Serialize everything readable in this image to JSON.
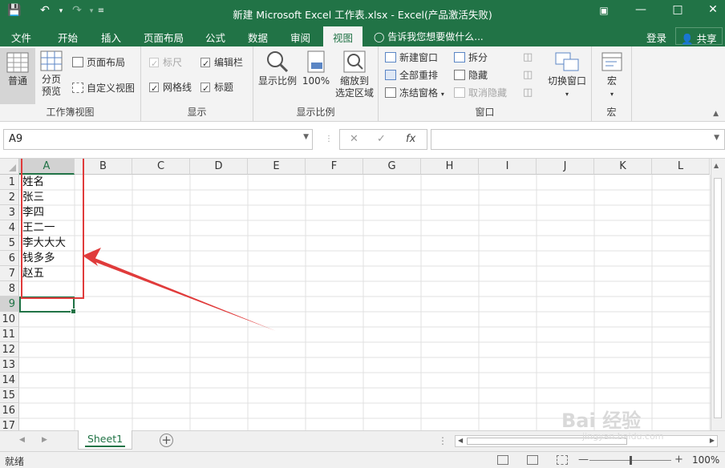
{
  "window": {
    "title": "新建 Microsoft Excel 工作表.xlsx - Excel(产品激活失败)"
  },
  "menu_tabs": [
    "文件",
    "开始",
    "插入",
    "页面布局",
    "公式",
    "数据",
    "审阅",
    "视图"
  ],
  "active_tab": "视图",
  "tell_me": "告诉我您想要做什么...",
  "account": {
    "login": "登录",
    "share": "共享"
  },
  "ribbon": {
    "workbook_views": {
      "label": "工作簿视图",
      "normal": "普通",
      "page_break_line1": "分页",
      "page_break_line2": "预览",
      "page_layout": "页面布局",
      "custom_views": "自定义视图"
    },
    "show": {
      "label": "显示",
      "ruler": "标尺",
      "formula_bar": "编辑栏",
      "gridlines": "网格线",
      "headings": "标题"
    },
    "zoom": {
      "label": "显示比例",
      "zoom": "显示比例",
      "hundred": "100%",
      "zoom_to_selection_line1": "缩放到",
      "zoom_to_selection_line2": "选定区域"
    },
    "window": {
      "label": "窗口",
      "new_window": "新建窗口",
      "arrange_all": "全部重排",
      "freeze_panes": "冻结窗格",
      "split": "拆分",
      "hide": "隐藏",
      "unhide": "取消隐藏",
      "switch_windows": "切换窗口"
    },
    "macros": {
      "label": "宏",
      "macros": "宏"
    }
  },
  "formula_bar": {
    "name_box": "A9",
    "fx": "fx",
    "formula": ""
  },
  "grid": {
    "columns": [
      "A",
      "B",
      "C",
      "D",
      "E",
      "F",
      "G",
      "H",
      "I",
      "J",
      "K",
      "L"
    ],
    "rows": [
      "1",
      "2",
      "3",
      "4",
      "5",
      "6",
      "7",
      "8",
      "9",
      "10",
      "11",
      "12",
      "13",
      "14",
      "15",
      "16",
      "17"
    ],
    "column_a": [
      "姓名",
      "张三",
      "李四",
      "王二一",
      "李大大大",
      "钱多多",
      "赵五"
    ],
    "selected_cell": "A9"
  },
  "sheets": {
    "tabs": [
      "Sheet1"
    ],
    "active": "Sheet1"
  },
  "status": {
    "ready": "就绪",
    "zoom": "100%"
  },
  "watermark": {
    "brand": "Bai 经验",
    "url": "jingyan.baidu.com"
  },
  "colors": {
    "accent": "#217346",
    "highlight": "#e03b3b"
  }
}
